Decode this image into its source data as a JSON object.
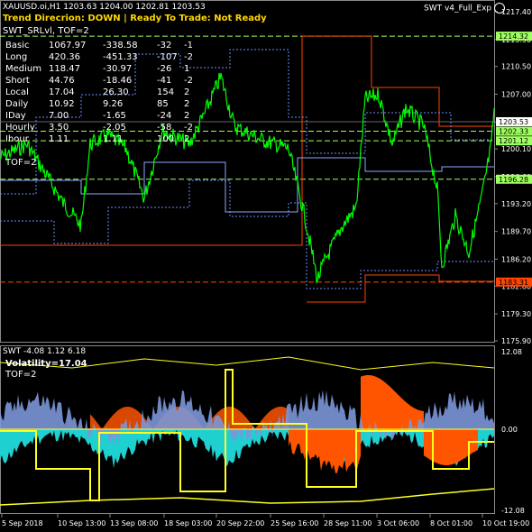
{
  "header": {
    "symbol_line": "XAUUSD.oi,H1  1203.63 1204.00 1202.81 1203.53",
    "indicator_name": "SWT v4_Full_Exp",
    "trend_label": "Trend Direcrion:",
    "trend_value": "DOWN",
    "separator": "|",
    "ready_label": "Ready To Trade:",
    "ready_value": "Not Ready",
    "swt_srlvl": "SWT_SRLvl, TOF=2"
  },
  "table": [
    [
      "Basic",
      "1067.97",
      "-338.58",
      "-32",
      "-1"
    ],
    [
      "Long",
      "420.36",
      "-451.33",
      "-107",
      "-2"
    ],
    [
      "Medium",
      "118.47",
      "-30.97",
      "-26",
      "1"
    ],
    [
      "Short",
      "44.76",
      "-18.46",
      "-41",
      "-2"
    ],
    [
      "Local",
      "17.04",
      "26.30",
      "154",
      "2"
    ],
    [
      "Daily",
      "10.92",
      "9.26",
      "85",
      "2"
    ],
    [
      "IDay",
      "7.00",
      "-1.65",
      "-24",
      "2"
    ],
    [
      "Hourly",
      "3.50",
      "-2.05",
      "-58",
      "-2"
    ],
    [
      "Ihour",
      "1.11",
      "1.11",
      "100",
      "2"
    ]
  ],
  "tof_label": "TOF=2",
  "price_axis": {
    "ticks": [
      "1217.40",
      "1213.90",
      "1210.50",
      "1207.00",
      "1203.50",
      "1200.10",
      "1196.60",
      "1193.20",
      "1189.70",
      "1186.20",
      "1182.80",
      "1179.30",
      "1175.90"
    ],
    "markers": [
      {
        "label": "1214.32",
        "color": "#a0ff60",
        "text_color": "#000"
      },
      {
        "label": "1203.53",
        "color": "#ffffff",
        "text_color": "#000"
      },
      {
        "label": "1202.33",
        "color": "#a0ff60",
        "text_color": "#000"
      },
      {
        "label": "1201.12",
        "color": "#a0ff60",
        "text_color": "#000"
      },
      {
        "label": "1196.28",
        "color": "#a0ff60",
        "text_color": "#000"
      },
      {
        "label": "1183.31",
        "color": "#ff4500",
        "text_color": "#000"
      }
    ]
  },
  "sub": {
    "title": "SWT -4.08 1.12 6.18",
    "volatility": "Volatility=17.04",
    "tof": "TOF=2",
    "ticks": [
      "12.08",
      "0.00",
      "-12.08"
    ]
  },
  "time_axis": [
    "5 Sep 2018",
    "10 Sep 13:00",
    "13 Sep 08:00",
    "18 Sep 03:00",
    "20 Sep 22:00",
    "25 Sep 16:00",
    "28 Sep 11:00",
    "3 Oct 06:00",
    "8 Oct 01:00",
    "10 Oct 19:00"
  ],
  "colors": {
    "price": "#00ff00",
    "resistance": "#ff4500",
    "support_dotted": "#6b8cff",
    "level": "#a0ff60",
    "orange_fill": "#ff5500",
    "blue_fill": "#7b96d8",
    "cyan_fill": "#1fd0d0",
    "yellow": "#ffff20"
  }
}
